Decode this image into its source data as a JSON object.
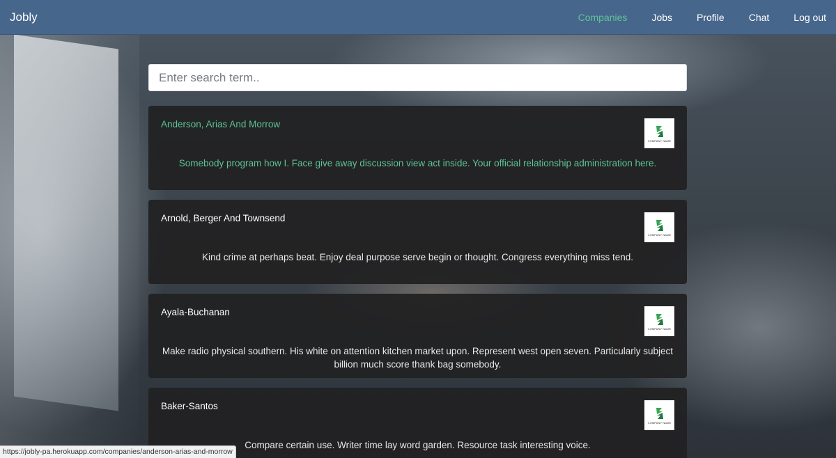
{
  "navbar": {
    "brand": "Jobly",
    "links": [
      {
        "label": "Companies",
        "active": true
      },
      {
        "label": "Jobs"
      },
      {
        "label": "Profile"
      },
      {
        "label": "Chat"
      },
      {
        "label": "Log out"
      }
    ]
  },
  "search": {
    "placeholder": "Enter search term.."
  },
  "companies": [
    {
      "name": "Anderson, Arias And Morrow",
      "description": "Somebody program how I. Face give away discussion view act inside. Your official relationship administration here.",
      "logo_text": "COMPANY NAME"
    },
    {
      "name": "Arnold, Berger And Townsend",
      "description": "Kind crime at perhaps beat. Enjoy deal purpose serve begin or thought. Congress everything miss tend.",
      "logo_text": "COMPANY NAME"
    },
    {
      "name": "Ayala-Buchanan",
      "description": "Make radio physical southern. His white on attention kitchen market upon. Represent west open seven. Particularly subject billion much score thank bag somebody.",
      "logo_text": "COMPANY NAME"
    },
    {
      "name": "Baker-Santos",
      "description": "Compare certain use. Writer time lay word garden. Resource task interesting voice.",
      "logo_text": "COMPANY NAME"
    }
  ],
  "status_url": "https://jobly-pa.herokuapp.com/companies/anderson-arias-and-morrow",
  "colors": {
    "navbar": "#47668c",
    "accent": "#5ec395",
    "card": "#222223"
  }
}
